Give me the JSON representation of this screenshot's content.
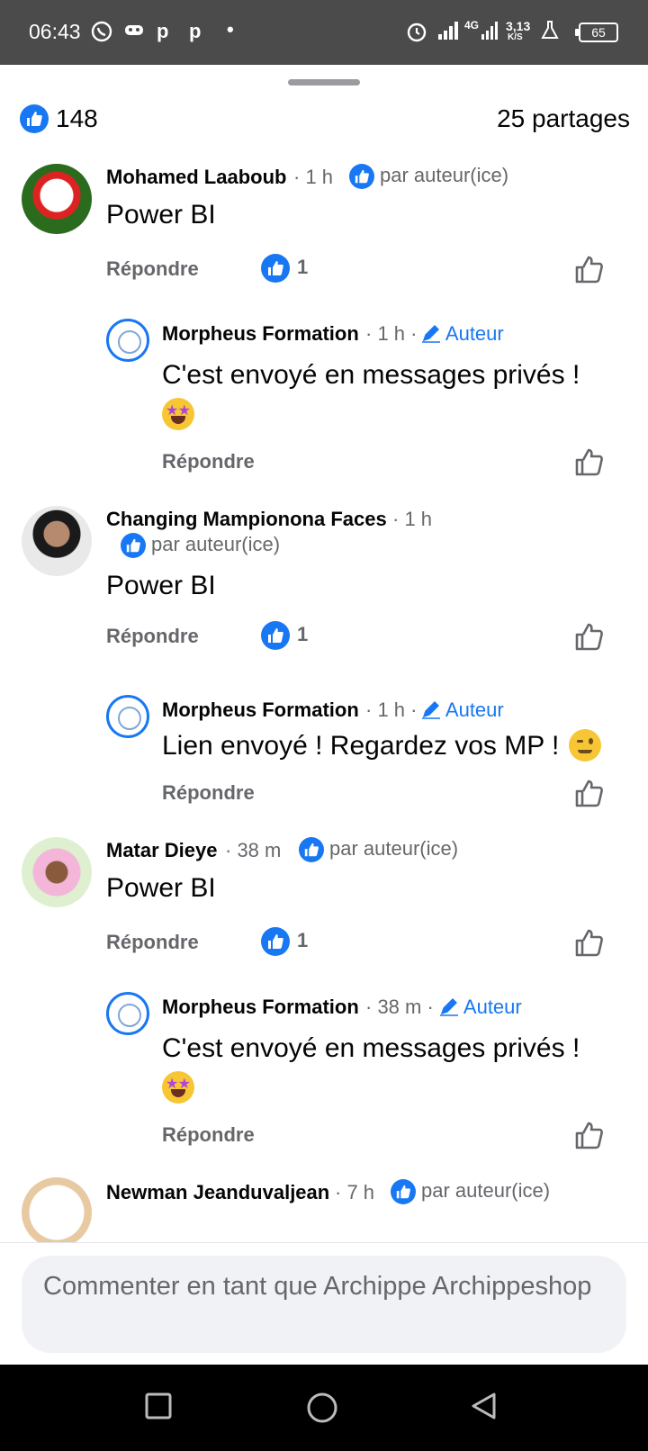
{
  "status_bar": {
    "time": "06:43",
    "network_label": "4G",
    "speed": "3,13",
    "speed_unit": "K/S",
    "battery": "65"
  },
  "summary": {
    "like_count": "148",
    "shares": "25 partages"
  },
  "labels": {
    "reply": "Répondre",
    "by_author": "par auteur(ice)",
    "author_badge": "Auteur"
  },
  "comments": [
    {
      "name": "Mohamed Laaboub",
      "time": "· 1 h",
      "text": "Power BI",
      "reactions": "1",
      "reply": {
        "name": "Morpheus Formation",
        "time": "· 1 h ·",
        "text": "C'est envoyé en messages privés !",
        "emoji": "star-struck-emoji"
      }
    },
    {
      "name": "Changing Mampionona Faces",
      "time": "· 1 h",
      "text": "Power BI",
      "reactions": "1",
      "reply": {
        "name": "Morpheus Formation",
        "time": "· 1 h ·",
        "text": "Lien envoyé ! Regardez vos MP !",
        "emoji": "winking-emoji"
      }
    },
    {
      "name": "Matar Dieye",
      "time": "· 38 m",
      "text": "Power BI",
      "reactions": "1",
      "reply": {
        "name": "Morpheus Formation",
        "time": "· 38 m ·",
        "text": "C'est envoyé en messages privés !",
        "emoji": "star-struck-emoji"
      }
    },
    {
      "name": "Newman Jeanduvaljean",
      "time": "· 7 h"
    }
  ],
  "composer": {
    "placeholder": "Commenter en tant que Archippe Archippeshop"
  },
  "colors": {
    "accent": "#1877f2",
    "status_bar": "#4b4b4b",
    "secondary_text": "#65676b"
  }
}
